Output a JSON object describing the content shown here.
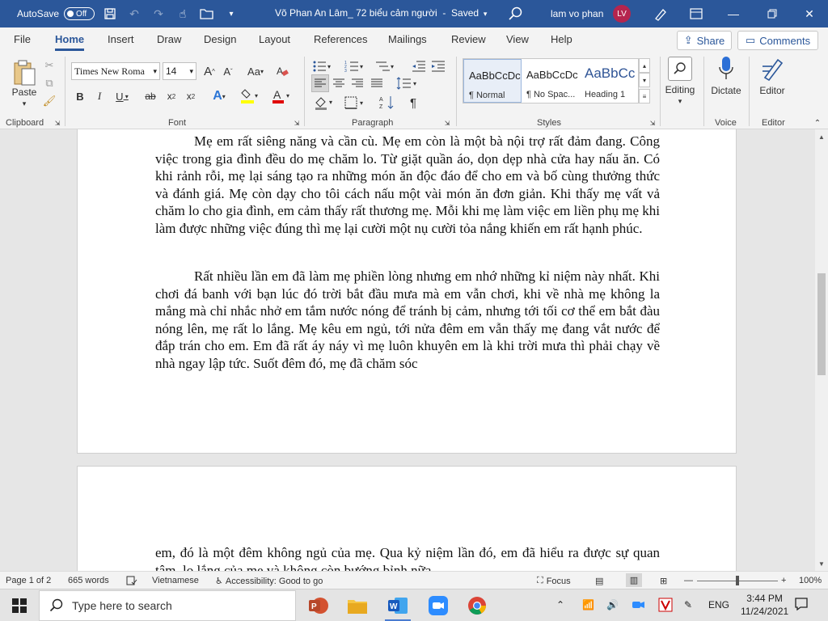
{
  "titlebar": {
    "autosave_label": "AutoSave",
    "autosave_state": "Off",
    "doc_title": "Võ Phan An Lâm_ 72 biểu cảm người",
    "save_status": "Saved",
    "user_name": "lam vo phan",
    "user_initials": "LV"
  },
  "tabs": [
    "File",
    "Home",
    "Insert",
    "Draw",
    "Design",
    "Layout",
    "References",
    "Mailings",
    "Review",
    "View",
    "Help"
  ],
  "active_tab": "Home",
  "share_label": "Share",
  "comments_label": "Comments",
  "ribbon": {
    "paste_label": "Paste",
    "font_name": "Times New Roma",
    "font_size": "14",
    "styles": [
      {
        "preview": "AaBbCcDc",
        "name": "¶ Normal"
      },
      {
        "preview": "AaBbCcDc",
        "name": "¶ No Spac..."
      },
      {
        "preview": "AaBbCc",
        "name": "Heading 1"
      }
    ],
    "editing_label": "Editing",
    "dictate_label": "Dictate",
    "editor_label": "Editor",
    "groups": {
      "clipboard": "Clipboard",
      "font": "Font",
      "paragraph": "Paragraph",
      "styles": "Styles",
      "voice": "Voice",
      "editor": "Editor"
    }
  },
  "document": {
    "paragraphs": [
      "Mẹ em rất siêng năng và cần cù. Mẹ em còn là một bà nội trợ rất đảm đang. Công việc trong gia đình đều do mẹ chăm lo. Từ giặt quần áo, dọn dẹp nhà cửa hay nấu ăn. Có khi rảnh rỗi, mẹ lại sáng tạo ra những món ăn độc đáo để cho em và bố cùng thưởng thức và đánh giá. Mẹ còn dạy cho tôi cách nấu một vài món ăn đơn giản. Khi thấy mẹ vất vả chăm lo cho gia đình, em cảm thấy rất thương mẹ. Mỗi khi mẹ làm việc em liền phụ mẹ khi làm được những việc đúng thì mẹ lại cười một nụ cười tỏa nắng khiến em rất hạnh phúc.",
      "Rất nhiều lần em đã làm mẹ phiền lòng nhưng em nhớ những kỉ niệm này nhất. Khi chơi đá banh với bạn lúc đó trời bắt đầu mưa mà em vẫn chơi, khi về nhà mẹ không la mắng mà chỉ nhắc nhở em tắm nước nóng để tránh bị cảm, nhưng tới tối cơ thể em bắt đàu nóng lên, mẹ rất lo lắng. Mẹ kêu em ngủ, tới nửa đêm em vẫn thấy mẹ đang vắt nước để đắp trán cho em. Em đã rất áy náy vì mẹ luôn khuyên em là khi trời mưa thì phải chạy về nhà ngay lập tức. Suốt đêm đó, mẹ đã chăm sóc",
      "em, đó là một đêm không ngủ của mẹ. Qua kỷ niệm lần đó, em đã hiểu ra được sự quan tâm, lo lắng của mẹ và không còn bướng bỉnh nữa."
    ]
  },
  "statusbar": {
    "page": "Page 1 of 2",
    "words": "665 words",
    "language": "Vietnamese",
    "accessibility": "Accessibility: Good to go",
    "focus": "Focus",
    "zoom": "100%"
  },
  "taskbar": {
    "search_placeholder": "Type here to search",
    "language": "ENG",
    "time": "3:44 PM",
    "date": "11/24/2021"
  },
  "colors": {
    "accent": "#2b579a",
    "avatar": "#b5254e"
  }
}
